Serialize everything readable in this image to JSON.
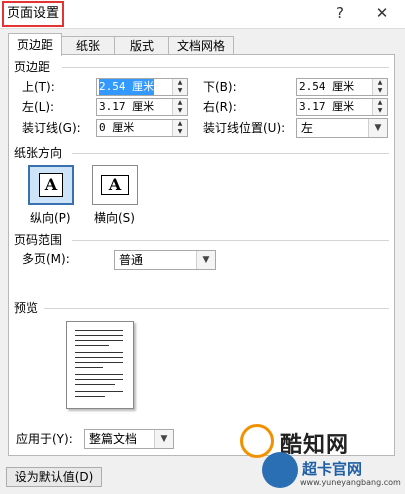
{
  "window": {
    "title": "页面设置",
    "help": "?",
    "close": "✕"
  },
  "tabs": [
    {
      "label": "页边距",
      "active": true
    },
    {
      "label": "纸张",
      "active": false
    },
    {
      "label": "版式",
      "active": false
    },
    {
      "label": "文档网格",
      "active": false
    }
  ],
  "margins": {
    "section": "页边距",
    "top": {
      "label": "上(T):",
      "value": "2.54 厘米"
    },
    "bottom": {
      "label": "下(B):",
      "value": "2.54 厘米"
    },
    "left": {
      "label": "左(L):",
      "value": "3.17 厘米"
    },
    "right": {
      "label": "右(R):",
      "value": "3.17 厘米"
    },
    "gutter": {
      "label": "装订线(G):",
      "value": "0 厘米"
    },
    "gutter_pos": {
      "label": "装订线位置(U):",
      "value": "左"
    }
  },
  "orientation": {
    "section": "纸张方向",
    "portrait": {
      "label": "纵向(P)",
      "glyph": "A",
      "selected": true
    },
    "landscape": {
      "label": "横向(S)",
      "glyph": "A",
      "selected": false
    }
  },
  "pages": {
    "section": "页码范围",
    "multiple": {
      "label": "多页(M):",
      "value": "普通"
    }
  },
  "preview": {
    "section": "预览"
  },
  "apply": {
    "label": "应用于(Y):",
    "value": "整篇文档"
  },
  "footer": {
    "default_button": "设为默认值(D)"
  },
  "watermark": {
    "brand": "酷知网",
    "brand2": "超卡官网",
    "url": "www.yuneyangbang.com"
  },
  "colors": {
    "highlight": "#e53333",
    "selection": "#3399ff",
    "accent": "#3a6fb0"
  }
}
